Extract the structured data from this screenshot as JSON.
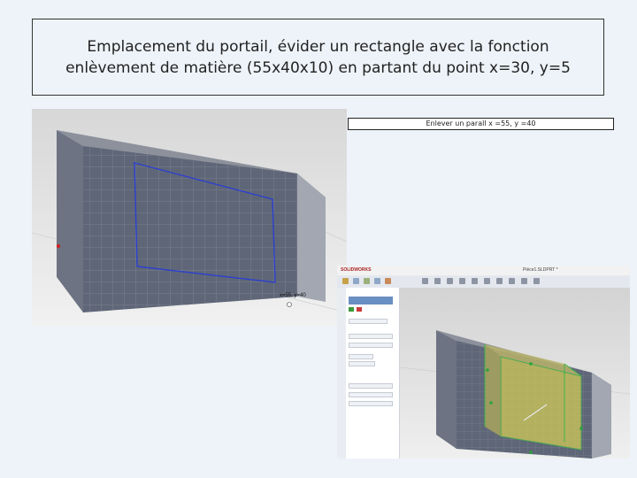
{
  "slide": {
    "title": "Emplacement du portail, évider un rectangle avec la fonction enlèvement de matière (55x40x10) en partant du point x=30, y=5",
    "caption": "Enlever un parall x =55, y =40"
  },
  "screenshot1": {
    "dimension_label": "x=55, y=40"
  },
  "screenshot2": {
    "app_logo": "SOLIDWORKS",
    "document_title": "Pièce1.SLDPRT *"
  },
  "colors": {
    "model_face": "#5f6677",
    "model_side": "#a2a7b1",
    "model_top": "#8c919c",
    "sketch_line": "#2b3fd0",
    "cut_fill": "#c9c35a",
    "accent": "#6a8fc2"
  }
}
